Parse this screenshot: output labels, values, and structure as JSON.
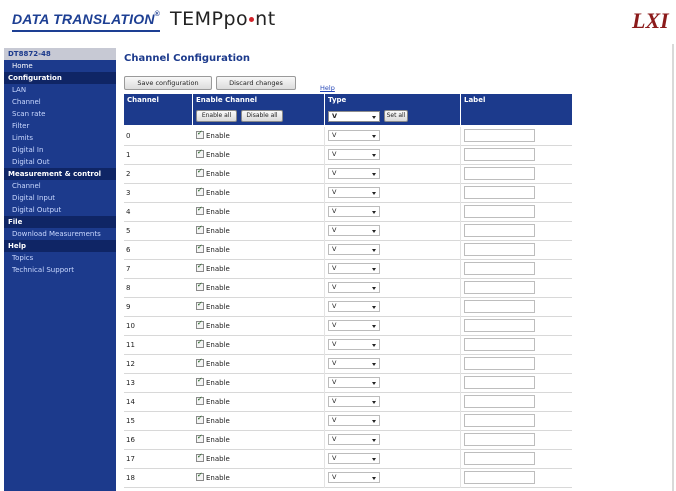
{
  "header": {
    "brand_dt": "DATA TRANSLATION",
    "brand_tm": "®",
    "brand_tp_a": "TEMP",
    "brand_tp_b": "po",
    "brand_tp_c": "nt",
    "brand_lxi": "LXI"
  },
  "sidebar": {
    "device": "DT8872-48",
    "home": "Home",
    "sections": [
      {
        "title": "Configuration",
        "items": [
          "LAN",
          "Channel",
          "Scan rate",
          "Filter",
          "Limits",
          "Digital In",
          "Digital Out"
        ]
      },
      {
        "title": "Measurement & control",
        "items": [
          "Channel",
          "Digital Input",
          "Digital Output"
        ]
      },
      {
        "title": "File",
        "items": [
          "Download Measurements"
        ]
      },
      {
        "title": "Help",
        "items": [
          "Topics",
          "Technical Support"
        ]
      }
    ]
  },
  "main": {
    "title": "Channel Configuration",
    "save_label": "Save configuration",
    "discard_label": "Discard changes",
    "help_label": "Help",
    "columns": {
      "channel": "Channel",
      "enable": "Enable Channel",
      "type": "Type",
      "label": "Label"
    },
    "enable_all": "Enable all",
    "disable_all": "Disable all",
    "type_all_value": "V",
    "set_all": "Set all",
    "enable_text": "Enable",
    "rows": [
      {
        "channel": "0",
        "enabled": true,
        "type": "V",
        "label": ""
      },
      {
        "channel": "1",
        "enabled": true,
        "type": "V",
        "label": ""
      },
      {
        "channel": "2",
        "enabled": true,
        "type": "V",
        "label": ""
      },
      {
        "channel": "3",
        "enabled": true,
        "type": "V",
        "label": ""
      },
      {
        "channel": "4",
        "enabled": true,
        "type": "V",
        "label": ""
      },
      {
        "channel": "5",
        "enabled": true,
        "type": "V",
        "label": ""
      },
      {
        "channel": "6",
        "enabled": true,
        "type": "V",
        "label": ""
      },
      {
        "channel": "7",
        "enabled": true,
        "type": "V",
        "label": ""
      },
      {
        "channel": "8",
        "enabled": true,
        "type": "V",
        "label": ""
      },
      {
        "channel": "9",
        "enabled": true,
        "type": "V",
        "label": ""
      },
      {
        "channel": "10",
        "enabled": true,
        "type": "V",
        "label": ""
      },
      {
        "channel": "11",
        "enabled": true,
        "type": "V",
        "label": ""
      },
      {
        "channel": "12",
        "enabled": true,
        "type": "V",
        "label": ""
      },
      {
        "channel": "13",
        "enabled": true,
        "type": "V",
        "label": ""
      },
      {
        "channel": "14",
        "enabled": true,
        "type": "V",
        "label": ""
      },
      {
        "channel": "15",
        "enabled": true,
        "type": "V",
        "label": ""
      },
      {
        "channel": "16",
        "enabled": true,
        "type": "V",
        "label": ""
      },
      {
        "channel": "17",
        "enabled": true,
        "type": "V",
        "label": ""
      },
      {
        "channel": "18",
        "enabled": true,
        "type": "V",
        "label": ""
      }
    ]
  },
  "colors": {
    "nav": "#1c3a8c",
    "nav_dark": "#0f2565",
    "brand": "#1d3f93",
    "lxi": "#8b1a1a",
    "accent_dot": "#d2232a"
  }
}
